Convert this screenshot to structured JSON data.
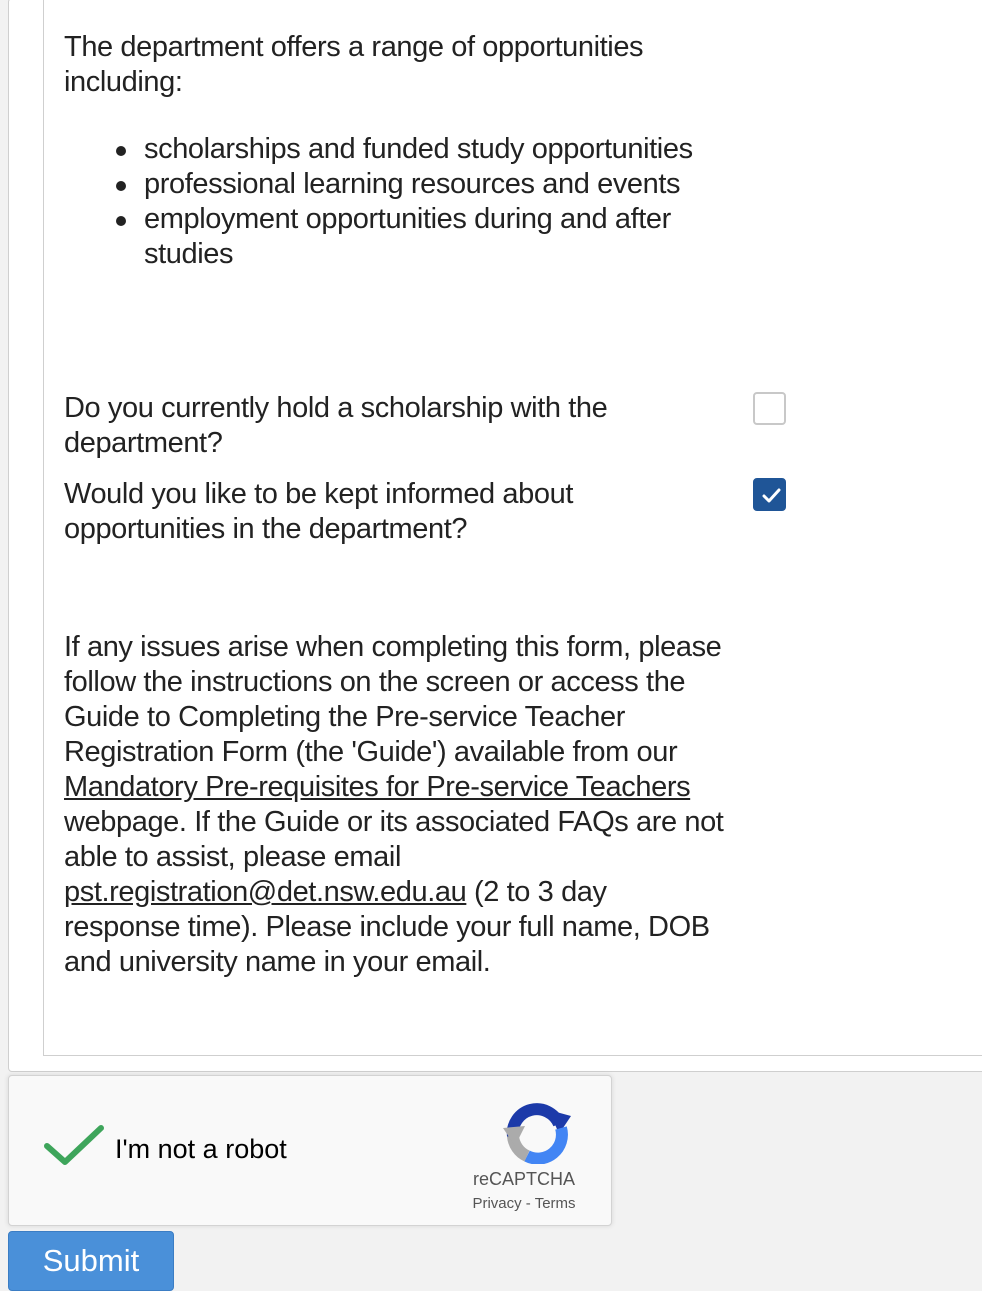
{
  "intro": {
    "text": "The department offers a range of opportunities including:",
    "items": [
      "scholarships and funded study opportunities",
      "professional learning resources and events",
      "employment opportunities during and after studies"
    ]
  },
  "questions": [
    {
      "label": "Do you currently hold a scholarship with the department?",
      "checked": false
    },
    {
      "label": "Would you like to be kept informed about opportunities in the department?",
      "checked": true
    }
  ],
  "help": {
    "part1": "If any issues arise when completing this form, please follow the instructions on the screen or access the ",
    "guide_title": "Guide to Completing the Pre-service Teacher Registration Form",
    "part2": " (the 'Guide') available from our ",
    "link_text": "Mandatory Pre-requisites for Pre-service Teachers",
    "part3": " webpage. If the Guide or its associated FAQs are not able to assist, please email ",
    "email": "pst.registration@det.nsw.edu.au",
    "part4": " (2 to 3 day response time). Please include your full name, DOB and university name in your email."
  },
  "recaptcha": {
    "label": "I'm not a robot",
    "brand": "reCAPTCHA",
    "privacy": "Privacy",
    "separator": "-",
    "terms": "Terms",
    "verified": true
  },
  "submit_label": "Submit",
  "colors": {
    "checkbox_checked": "#1f5597",
    "submit_bg": "#4a90d9",
    "recaptcha_check": "#3ea55b"
  }
}
